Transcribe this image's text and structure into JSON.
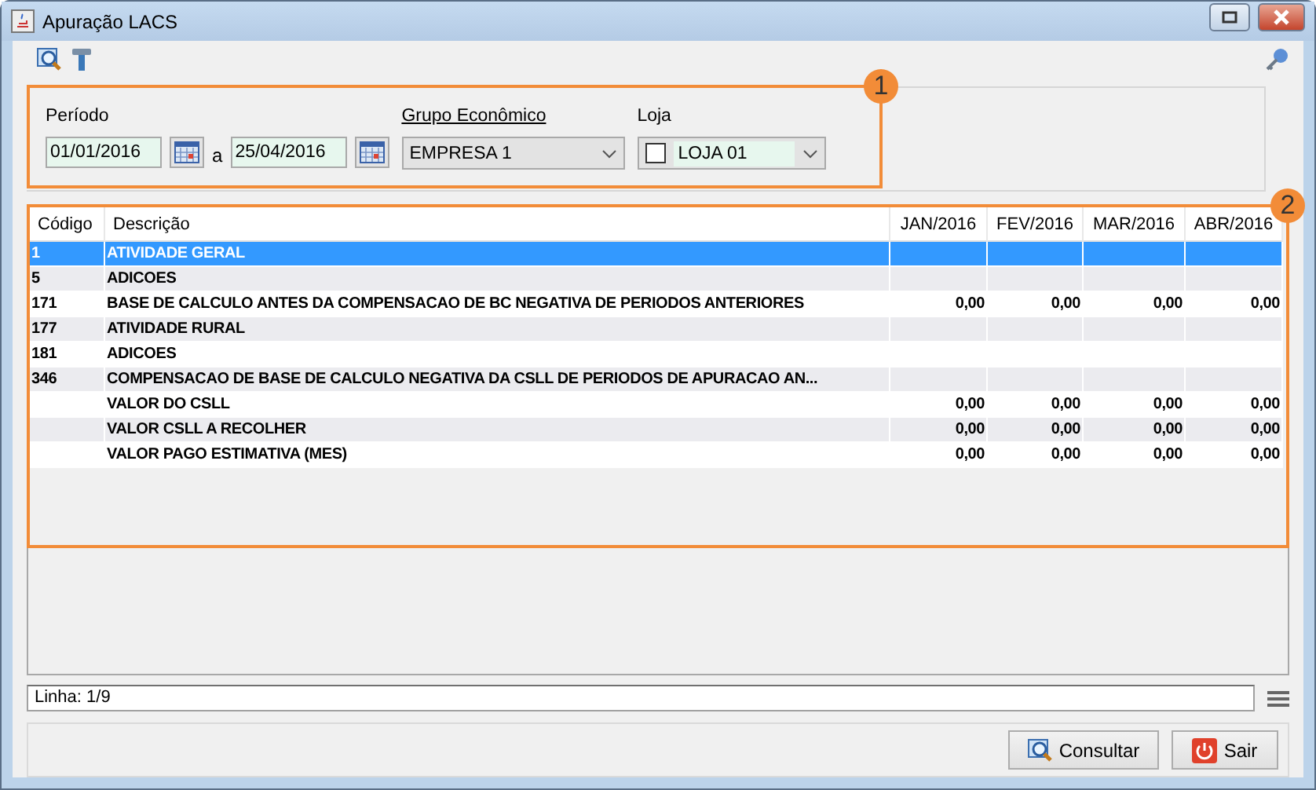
{
  "window": {
    "title": "Apuração LACS"
  },
  "filters": {
    "period_label": "Período",
    "start_date": "01/01/2016",
    "separator": "a",
    "end_date": "25/04/2016",
    "group_label": "Grupo Econômico",
    "group_value": "EMPRESA 1",
    "store_label": "Loja",
    "store_value": "LOJA 01",
    "store_checked": false
  },
  "annotations": [
    {
      "label": "1"
    },
    {
      "label": "2"
    }
  ],
  "table": {
    "columns": [
      "Código",
      "Descrição",
      "JAN/2016",
      "FEV/2016",
      "MAR/2016",
      "ABR/2016"
    ],
    "rows": [
      {
        "code": "1",
        "description": "ATIVIDADE GERAL",
        "selected": true
      },
      {
        "code": "5",
        "description": "ADICOES",
        "selected": false
      },
      {
        "code": "171",
        "description": "BASE DE CALCULO ANTES DA COMPENSACAO DE BC NEGATIVA DE PERIODOS ANTERIORES",
        "values": [
          "0,00",
          "0,00",
          "0,00",
          "0,00"
        ],
        "selected": false
      },
      {
        "code": "177",
        "description": "ATIVIDADE RURAL",
        "selected": false
      },
      {
        "code": "181",
        "description": "ADICOES",
        "selected": false
      },
      {
        "code": "346",
        "description": "COMPENSACAO DE BASE DE CALCULO NEGATIVA DA CSLL DE PERIODOS DE APURACAO AN...",
        "selected": false
      },
      {
        "description": "VALOR DO CSLL",
        "values": [
          "0,00",
          "0,00",
          "0,00",
          "0,00"
        ],
        "selected": false
      },
      {
        "description": "VALOR CSLL A RECOLHER",
        "values": [
          "0,00",
          "0,00",
          "0,00",
          "0,00"
        ],
        "selected": false
      },
      {
        "description": "VALOR PAGO ESTIMATIVA (MES)",
        "values": [
          "0,00",
          "0,00",
          "0,00",
          "0,00"
        ],
        "selected": false
      }
    ]
  },
  "status_bar": {
    "text": "Linha: 1/9"
  },
  "buttons": [
    {
      "kind": "search",
      "label": "Consultar"
    },
    {
      "kind": "exit",
      "label": "Sair"
    }
  ]
}
